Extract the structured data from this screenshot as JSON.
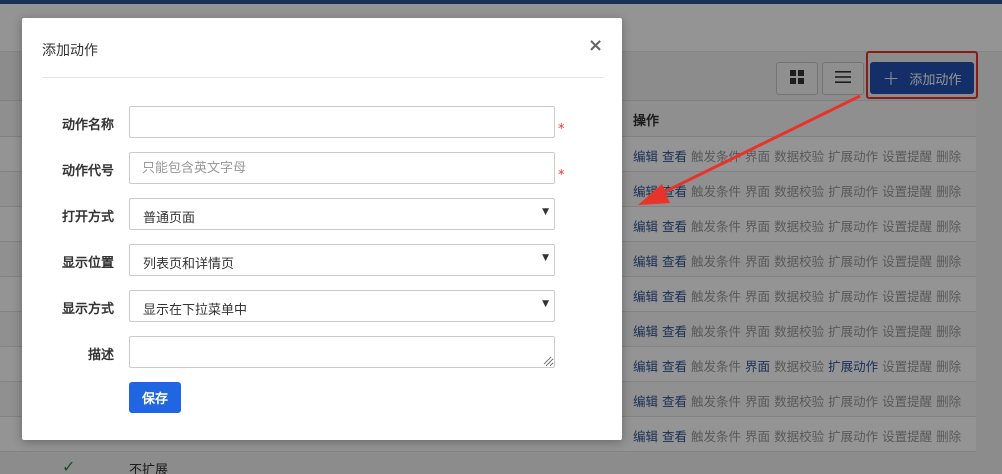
{
  "background": {
    "toolbar": {
      "grid_view_icon": "grid-icon",
      "list_view_icon": "list-icon",
      "add_action_label": "添加动作"
    },
    "table": {
      "header_actions_label": "操作",
      "row_actions": [
        "编辑",
        "查看",
        "触发条件",
        "界面",
        "数据校验",
        "扩展动作",
        "设置提醒",
        "删除"
      ],
      "last_row_check_icon": "check-icon",
      "last_row_text": "不扩展"
    }
  },
  "modal": {
    "title": "添加动作",
    "close_symbol": "×",
    "fields": {
      "action_name": {
        "label": "动作名称",
        "value": "",
        "required_mark": "*"
      },
      "action_code": {
        "label": "动作代号",
        "value": "",
        "placeholder": "只能包含英文字母",
        "required_mark": "*"
      },
      "open_mode": {
        "label": "打开方式",
        "selected": "普通页面"
      },
      "display_position": {
        "label": "显示位置",
        "selected": "列表页和详情页"
      },
      "display_mode": {
        "label": "显示方式",
        "selected": "显示在下拉菜单中"
      },
      "description": {
        "label": "描述",
        "value": ""
      }
    },
    "save_label": "保存"
  },
  "colors": {
    "primary": "#1f66e0",
    "toolbar_button": "#2452b3",
    "highlight": "#e8332b",
    "link": "#2f5596",
    "dim_link": "#9a9a9a"
  }
}
